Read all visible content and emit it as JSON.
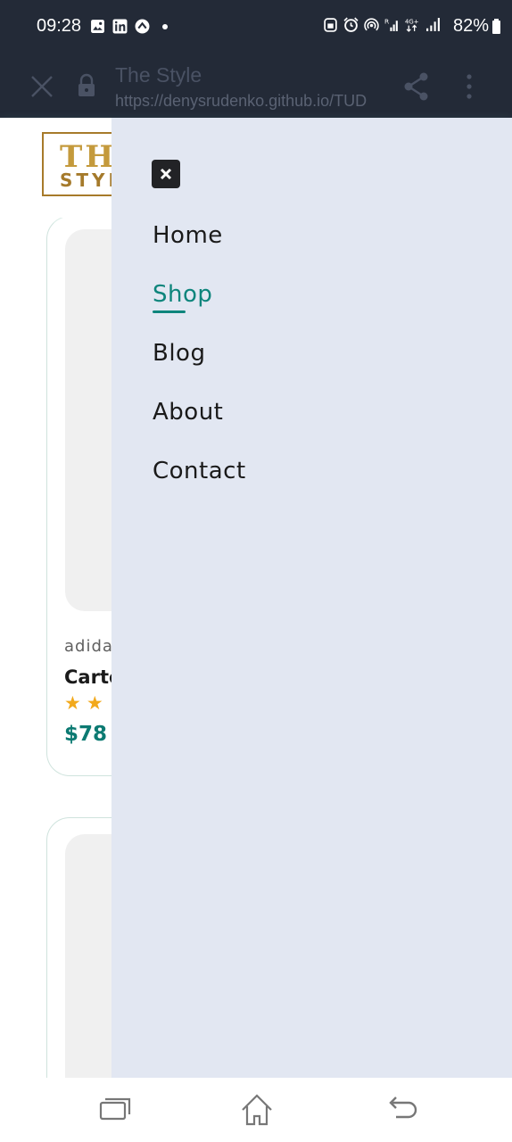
{
  "status_bar": {
    "time": "09:28",
    "battery": "82%",
    "left_icons": [
      "image-icon",
      "linkedin-icon",
      "vpn-icon",
      "notification-dot"
    ],
    "right_icons": [
      "lock-badge-icon",
      "alarm-icon",
      "hotspot-icon",
      "signal-r-icon",
      "4g-plus-icon",
      "signal-icon"
    ]
  },
  "browser": {
    "title": "The Style",
    "url": "https://denysrudenko.github.io/TUD"
  },
  "site": {
    "logo_line1": "THE",
    "logo_line2": "STYLE",
    "cards": [
      {
        "brand": "adidas",
        "name": "Carto",
        "rating": 2,
        "price": "$78"
      }
    ]
  },
  "drawer": {
    "close_label": "close",
    "nav": [
      {
        "label": "Home",
        "active": false
      },
      {
        "label": "Shop",
        "active": true
      },
      {
        "label": "Blog",
        "active": false
      },
      {
        "label": "About",
        "active": false
      },
      {
        "label": "Contact",
        "active": false
      }
    ]
  },
  "colors": {
    "accent": "#0e857c",
    "drawer_bg": "#e2e7f2",
    "status_bar_bg": "#232a37",
    "star": "#f2a91c",
    "logo_gold": "#c49a3c"
  }
}
